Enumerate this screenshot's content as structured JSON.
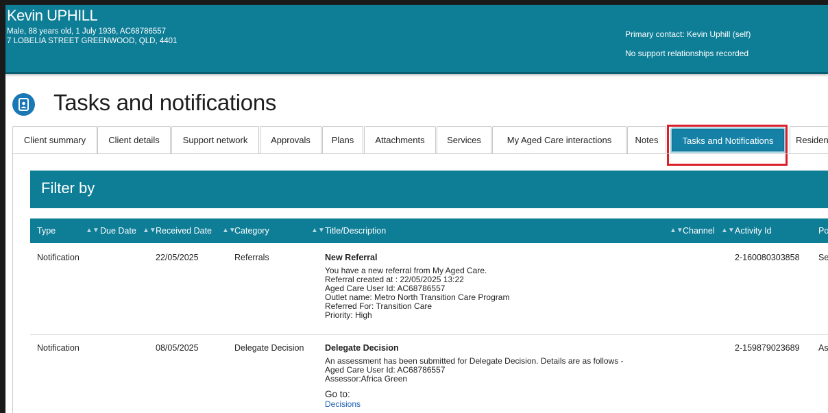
{
  "patient": {
    "name": "Kevin UPHILL",
    "line1": "Male, 88 years old, 1 July 1936, AC68786557",
    "line2": "7 LOBELIA STREET GREENWOOD, QLD, 4401",
    "primary_contact": "Primary contact: Kevin Uphill (self)",
    "support": "No support relationships recorded"
  },
  "page": {
    "title": "Tasks and notifications",
    "icon": "client-file-icon"
  },
  "tabs": [
    {
      "label": "Client summary"
    },
    {
      "label": "Client details"
    },
    {
      "label": "Support network"
    },
    {
      "label": "Approvals"
    },
    {
      "label": "Plans"
    },
    {
      "label": "Attachments"
    },
    {
      "label": "Services"
    },
    {
      "label": "My Aged Care interactions"
    },
    {
      "label": "Notes"
    },
    {
      "label": "Tasks and Notifications"
    },
    {
      "label": "Residen"
    }
  ],
  "filter": {
    "title": "Filter by"
  },
  "table": {
    "headers": [
      "Type",
      "Due Date",
      "Received Date",
      "Category",
      "Title/Description",
      "Channel",
      "Activity Id",
      "Por"
    ],
    "rows": [
      {
        "type": "Notification",
        "due": "",
        "received": "22/05/2025",
        "category": "Referrals",
        "title": "New Referral",
        "lines": [
          "You have a new referral from My Aged Care.",
          "Referral created at : 22/05/2025 13:22",
          "Aged Care User Id: AC68786557",
          "Outlet name: Metro North Transition Care Program",
          "Referred For: Transition Care",
          "Priority: High"
        ],
        "activity": "2-160080303858",
        "portal": "Ser"
      },
      {
        "type": "Notification",
        "due": "",
        "received": "08/05/2025",
        "category": "Delegate Decision",
        "title": "Delegate Decision",
        "lines": [
          "An assessment has been submitted for Delegate Decision. Details are as follows -",
          "Aged Care User Id: AC68786557",
          "Assessor:Africa Green"
        ],
        "goto": "Go to:",
        "link": "Decisions",
        "activity": "2-159879023689",
        "portal": "Ass"
      }
    ]
  },
  "colors": {
    "header_bg": "#0e7d96",
    "active_tab": "#1581a6",
    "highlight": "#d9202a"
  }
}
